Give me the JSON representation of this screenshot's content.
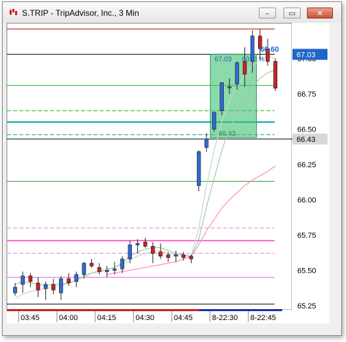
{
  "window": {
    "title": "S.TRIP - TripAdvisor, Inc., 3 Min",
    "icons": {
      "app": "candlestick-chart-icon",
      "minimize": "minimize-icon",
      "maximize": "maximize-icon",
      "close": "close-icon"
    },
    "minimize_glyph": "–",
    "maximize_glyph": "▭",
    "close_glyph": "✕"
  },
  "chart_data": {
    "type": "candlestick",
    "symbol": "S.TRIP",
    "interval": "3 Min",
    "ylim": [
      65.22,
      67.25
    ],
    "y_ticks": [
      65.25,
      65.5,
      65.75,
      66.0,
      66.25,
      66.5,
      66.75,
      67.0
    ],
    "y_tick_labels": [
      "65.25",
      "65.50",
      "65.75",
      "66.00",
      "66.25",
      "66.50",
      "66.75",
      "67.00"
    ],
    "x_tick_labels": [
      "03:45",
      "04:00",
      "04:15",
      "04:30",
      "04:45",
      "8-22:30",
      "8-22:45"
    ],
    "x_tick_index": [
      1,
      6,
      11,
      16,
      21,
      26,
      31
    ],
    "candles": [
      {
        "o": 65.34,
        "h": 65.41,
        "l": 65.32,
        "c": 65.38
      },
      {
        "o": 65.4,
        "h": 65.49,
        "l": 65.34,
        "c": 65.46
      },
      {
        "o": 65.46,
        "h": 65.48,
        "l": 65.38,
        "c": 65.42
      },
      {
        "o": 65.41,
        "h": 65.45,
        "l": 65.31,
        "c": 65.36
      },
      {
        "o": 65.37,
        "h": 65.42,
        "l": 65.29,
        "c": 65.4
      },
      {
        "o": 65.4,
        "h": 65.44,
        "l": 65.33,
        "c": 65.36
      },
      {
        "o": 65.34,
        "h": 65.46,
        "l": 65.29,
        "c": 65.44
      },
      {
        "o": 65.44,
        "h": 65.48,
        "l": 65.39,
        "c": 65.41
      },
      {
        "o": 65.42,
        "h": 65.49,
        "l": 65.38,
        "c": 65.47
      },
      {
        "o": 65.47,
        "h": 65.56,
        "l": 65.44,
        "c": 65.55
      },
      {
        "o": 65.55,
        "h": 65.58,
        "l": 65.52,
        "c": 65.53
      },
      {
        "o": 65.52,
        "h": 65.55,
        "l": 65.47,
        "c": 65.49
      },
      {
        "o": 65.49,
        "h": 65.53,
        "l": 65.45,
        "c": 65.5
      },
      {
        "o": 65.5,
        "h": 65.56,
        "l": 65.47,
        "c": 65.51
      },
      {
        "o": 65.51,
        "h": 65.6,
        "l": 65.48,
        "c": 65.58
      },
      {
        "o": 65.58,
        "h": 65.71,
        "l": 65.55,
        "c": 65.68
      },
      {
        "o": 65.68,
        "h": 65.72,
        "l": 65.62,
        "c": 65.69
      },
      {
        "o": 65.7,
        "h": 65.73,
        "l": 65.66,
        "c": 65.67
      },
      {
        "o": 65.67,
        "h": 65.7,
        "l": 65.55,
        "c": 65.62
      },
      {
        "o": 65.63,
        "h": 65.69,
        "l": 65.58,
        "c": 65.6
      },
      {
        "o": 65.61,
        "h": 65.63,
        "l": 65.56,
        "c": 65.59
      },
      {
        "o": 65.6,
        "h": 65.64,
        "l": 65.56,
        "c": 65.61
      },
      {
        "o": 65.61,
        "h": 65.63,
        "l": 65.57,
        "c": 65.59
      },
      {
        "o": 65.6,
        "h": 65.61,
        "l": 65.55,
        "c": 65.58
      },
      {
        "o": 66.1,
        "h": 66.35,
        "l": 66.06,
        "c": 66.34
      },
      {
        "o": 66.37,
        "h": 66.47,
        "l": 66.34,
        "c": 66.43
      },
      {
        "o": 66.5,
        "h": 66.58,
        "l": 66.48,
        "c": 66.62
      },
      {
        "o": 66.63,
        "h": 66.83,
        "l": 66.6,
        "c": 66.83
      },
      {
        "o": 66.8,
        "h": 66.86,
        "l": 66.75,
        "c": 66.8
      },
      {
        "o": 66.82,
        "h": 66.98,
        "l": 66.78,
        "c": 66.97
      },
      {
        "o": 66.98,
        "h": 67.08,
        "l": 66.8,
        "c": 66.89
      },
      {
        "o": 66.98,
        "h": 67.2,
        "l": 66.9,
        "c": 67.16
      },
      {
        "o": 67.16,
        "h": 67.21,
        "l": 66.99,
        "c": 67.07
      },
      {
        "o": 67.07,
        "h": 67.14,
        "l": 66.95,
        "c": 66.98
      },
      {
        "o": 66.98,
        "h": 67.0,
        "l": 66.77,
        "c": 66.79
      }
    ],
    "series": [
      {
        "name": "",
        "color": "#c5d9c5",
        "values": [
          65.3,
          65.33,
          65.35,
          65.36,
          65.37,
          65.38,
          65.39,
          65.41,
          65.43,
          65.45,
          65.48,
          65.5,
          65.51,
          65.52,
          65.54,
          65.57,
          65.6,
          65.62,
          65.63,
          65.64,
          65.62,
          65.61,
          65.6,
          65.6,
          65.8,
          66.1,
          66.35,
          66.55,
          66.7,
          66.8,
          66.88,
          66.95,
          66.99,
          67.02,
          67.0
        ]
      },
      {
        "name": "",
        "color": "#a8c8a8",
        "values": [
          65.4,
          65.42,
          65.41,
          65.4,
          65.39,
          65.4,
          65.4,
          65.41,
          65.43,
          65.46,
          65.48,
          65.49,
          65.5,
          65.52,
          65.55,
          65.6,
          65.63,
          65.65,
          65.66,
          65.66,
          65.64,
          65.62,
          65.61,
          65.6,
          65.72,
          65.95,
          66.15,
          66.35,
          66.5,
          66.62,
          66.72,
          66.8,
          66.86,
          66.9,
          66.92
        ]
      },
      {
        "name": "",
        "color": "#ff8cba",
        "values": [
          null,
          null,
          null,
          null,
          null,
          null,
          null,
          null,
          null,
          null,
          null,
          null,
          65.47,
          65.48,
          65.49,
          65.5,
          65.51,
          65.52,
          65.53,
          65.54,
          65.55,
          65.56,
          65.58,
          65.6,
          65.68,
          65.78,
          65.86,
          65.94,
          66.0,
          66.05,
          66.1,
          66.14,
          66.17,
          66.2,
          66.24
        ]
      }
    ],
    "hlines": [
      {
        "y": 67.21,
        "color": "#cc0000",
        "dash": false
      },
      {
        "y": 67.03,
        "color": "#000000",
        "dash": false
      },
      {
        "y": 66.81,
        "color": "#22bb22",
        "dash": false
      },
      {
        "y": 66.63,
        "color": "#22bb22",
        "dash": true
      },
      {
        "y": 66.55,
        "color": "#00aaaa",
        "dash": false,
        "width": 2
      },
      {
        "y": 66.46,
        "color": "#00aaaa",
        "dash": true
      },
      {
        "y": 66.43,
        "color": "#000000",
        "dash": false
      },
      {
        "y": 66.13,
        "color": "#339933",
        "dash": false
      },
      {
        "y": 65.8,
        "color": "#dd88dd",
        "dash": true
      },
      {
        "y": 65.71,
        "color": "#ff66cc",
        "dash": false,
        "width": 2
      },
      {
        "y": 65.62,
        "color": "#dd88dd",
        "dash": true
      },
      {
        "y": 65.45,
        "color": "#dd66dd",
        "dash": false
      },
      {
        "y": 65.26,
        "color": "#000000",
        "dash": false
      }
    ],
    "zone": {
      "y_top": 67.03,
      "y_bottom": 66.44,
      "x_from_index": 25.5,
      "x_to_index": 31.0,
      "color": "#3fbf6f"
    },
    "annotations": {
      "zone_label_top": "67.03",
      "zone_label_mid": "60",
      "zone_label_pct": "0 %",
      "zone_label_bottom": "66.43",
      "top_label": "60.60"
    },
    "price_markers": [
      {
        "y": 67.03,
        "label": "67.03",
        "bg": "#1f66c8",
        "fg": "#ffffff"
      },
      {
        "y": 66.43,
        "label": "66.43",
        "bg": "#d8d8d8",
        "fg": "#000000"
      }
    ],
    "colors": {
      "up": "#2f6ad8",
      "down": "#cc2222",
      "grid_bg": "#ffffff",
      "time_axis_bar": "#1a2fa8",
      "time_axis_red": "#cc2222"
    }
  }
}
